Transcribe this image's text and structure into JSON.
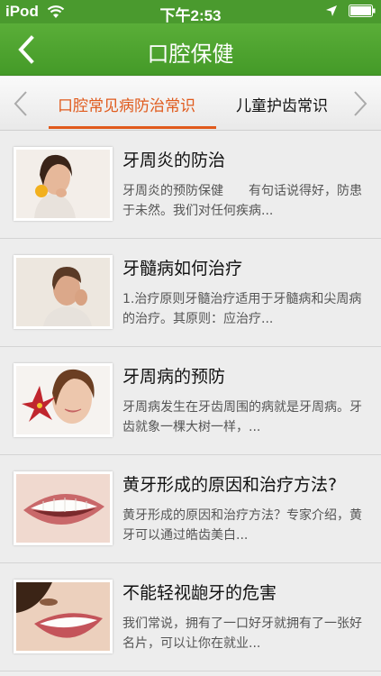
{
  "status_bar": {
    "carrier": "iPod",
    "time": "下午2:53"
  },
  "nav": {
    "title": "口腔保健",
    "back_icon": "chevron-left-icon"
  },
  "tabs": {
    "items": [
      {
        "label": "口腔常见病防治常识",
        "active": true
      },
      {
        "label": "儿童护齿常识",
        "active": false
      }
    ],
    "accent_color": "#e05a1c"
  },
  "articles": [
    {
      "title": "牙周炎的防治",
      "desc": "牙周炎的预防保健　　有句话说得好，防患于未然。我们对任何疾病..."
    },
    {
      "title": "牙髓病如何治疗",
      "desc": "1.治疗原则牙髓治疗适用于牙髓病和尖周病的治疗。其原则：应治疗..."
    },
    {
      "title": "牙周病的预防",
      "desc": "牙周病发生在牙齿周围的病就是牙周病。牙齿就象一棵大树一样，..."
    },
    {
      "title": "黄牙形成的原因和治疗方法?",
      "desc": "黄牙形成的原因和治疗方法？专家介绍，黄牙可以通过皓齿美白..."
    },
    {
      "title": "不能轻视龅牙的危害",
      "desc": "我们常说，拥有了一口好牙就拥有了一张好名片，可以让你在就业..."
    }
  ],
  "colors": {
    "nav_green": "#4a9a2e"
  }
}
